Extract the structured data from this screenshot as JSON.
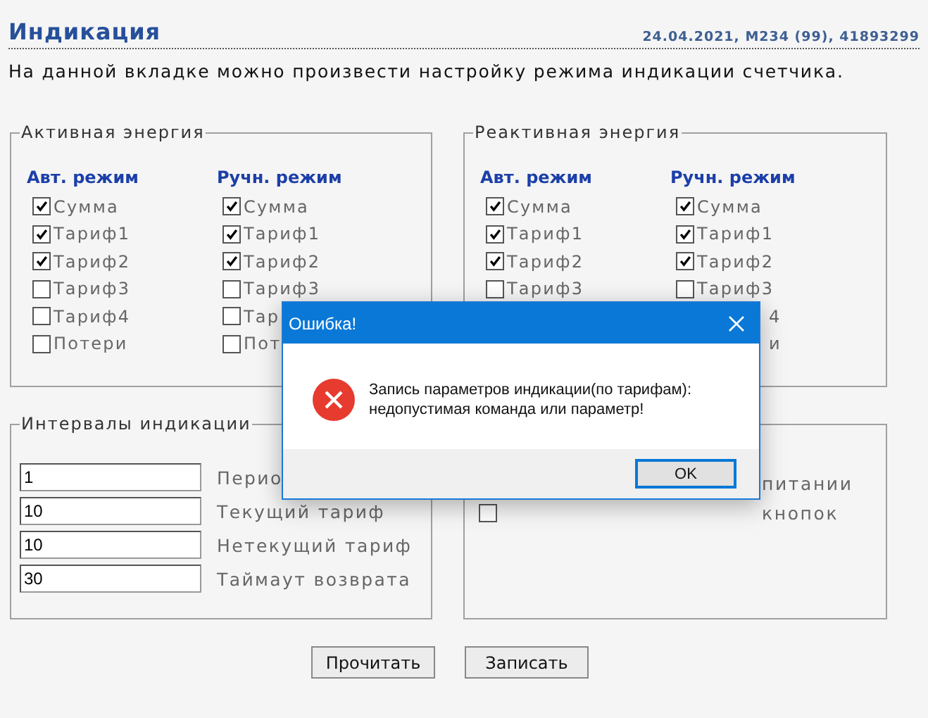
{
  "header": {
    "title": "Индикация",
    "meta": "24.04.2021, M234 (99), 41893299"
  },
  "description": "На данной вкладке можно произвести настройку режима индикации счетчика.",
  "energy_panels": [
    {
      "legend": "Активная энергия",
      "columns": [
        {
          "heading": "Авт. режим",
          "items": [
            {
              "label": "Сумма",
              "checked": true
            },
            {
              "label": "Тариф1",
              "checked": true
            },
            {
              "label": "Тариф2",
              "checked": true
            },
            {
              "label": "Тариф3",
              "checked": false
            },
            {
              "label": "Тариф4",
              "checked": false
            },
            {
              "label": "Потери",
              "checked": false
            }
          ]
        },
        {
          "heading": "Ручн. режим",
          "items": [
            {
              "label": "Сумма",
              "checked": true
            },
            {
              "label": "Тариф1",
              "checked": true
            },
            {
              "label": "Тариф2",
              "checked": true
            },
            {
              "label": "Тариф3",
              "checked": false
            },
            {
              "label": "Тар",
              "checked": false
            },
            {
              "label": "Пот",
              "checked": false
            }
          ]
        }
      ]
    },
    {
      "legend": "Реактивная энергия",
      "columns": [
        {
          "heading": "Авт. режим",
          "items": [
            {
              "label": "Сумма",
              "checked": true
            },
            {
              "label": "Тариф1",
              "checked": true
            },
            {
              "label": "Тариф2",
              "checked": true
            },
            {
              "label": "Тариф3",
              "checked": false
            }
          ]
        },
        {
          "heading": "Ручн. режим",
          "items": [
            {
              "label": "Сумма",
              "checked": true
            },
            {
              "label": "Тариф1",
              "checked": true
            },
            {
              "label": "Тариф2",
              "checked": true
            },
            {
              "label": "Тариф3",
              "checked": false
            },
            {
              "label": "4"
            },
            {
              "label": "и"
            }
          ]
        }
      ]
    }
  ],
  "intervals": {
    "legend": "Интервалы индикации",
    "fields": [
      {
        "value": "1",
        "label": "Перио"
      },
      {
        "value": "10",
        "label": "Текущий тариф"
      },
      {
        "value": "10",
        "label": "Нетекущий тариф"
      },
      {
        "value": "30",
        "label": "Таймаут возврата"
      }
    ]
  },
  "options": {
    "items": [
      {
        "label": "питании"
      },
      {
        "label": "кнопок",
        "checked": false
      }
    ]
  },
  "buttons": [
    "Прочитать",
    "Записать"
  ],
  "dialog": {
    "title": "Ошибка!",
    "message": [
      "Запись параметров индикации(по тарифам):",
      "недопустимая команда или параметр!"
    ],
    "ok": "OK"
  }
}
